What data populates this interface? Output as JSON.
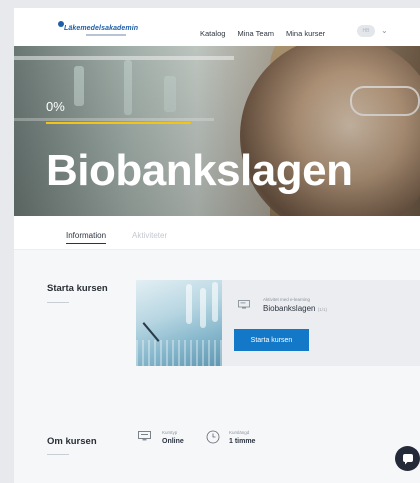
{
  "header": {
    "logo_text": "Läkemedelsakademin",
    "nav": [
      "Katalog",
      "Mina Team",
      "Mina kurser"
    ],
    "user_initials": "HB"
  },
  "hero": {
    "progress_text": "0%",
    "progress_value": 0,
    "course_title": "Biobankslagen",
    "accent_color": "#f0c419"
  },
  "tabs": [
    "Information",
    "Aktiviteter"
  ],
  "start_section": {
    "title": "Starta kursen",
    "last_activity_label": "Aktivitet med e-learning",
    "last_activity_value": "Biobankslagen",
    "last_activity_suffix": "(1/1)",
    "button_label": "Starta kursen",
    "button_color": "#1478c8"
  },
  "about_section": {
    "title": "Om kursen",
    "format_label": "Kurstyp",
    "format_value": "Online",
    "duration_label": "Kurslängd",
    "duration_value": "1 timme"
  },
  "icons": {
    "format": "monitor-icon",
    "duration": "clock-icon",
    "chat": "chat-icon"
  }
}
